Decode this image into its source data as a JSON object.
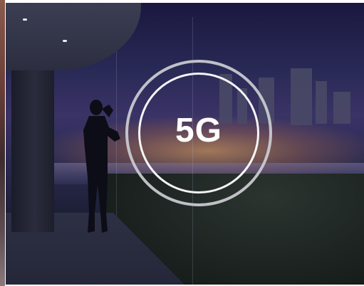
{
  "image": {
    "overlay_text": "5G",
    "accent_ring_color": "#ffffff",
    "secondary_ring_color": "#cfcfd4",
    "sky_color": "#2a2a57",
    "city_light_color": "#ffb45a"
  }
}
